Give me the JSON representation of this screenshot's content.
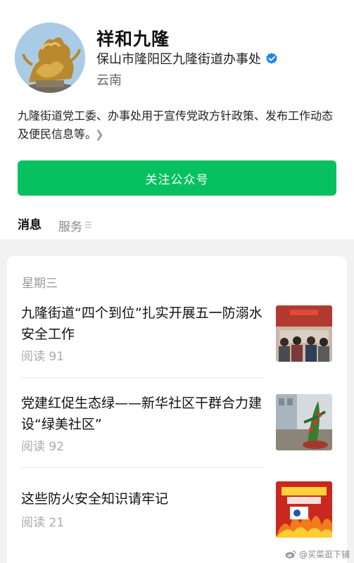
{
  "account": {
    "name": "祥和九隆",
    "org": "保山市隆阳区九隆街道办事处",
    "region": "云南",
    "description": "九隆街道党工委、办事处用于宣传党政方针政策、发布工作动态及便民信息等。",
    "verify_icon": "verified-badge-icon"
  },
  "follow_button": "关注公众号",
  "tabs": [
    {
      "label": "消息",
      "active": true
    },
    {
      "label": "服务",
      "active": false
    }
  ],
  "feed": {
    "day": "星期三",
    "articles": [
      {
        "title": "九隆街道“四个到位”扎实开展五一防溺水安全工作",
        "reads": "阅读 91"
      },
      {
        "title": "党建红促生态绿——新华社区干群合力建设“绿美社区”",
        "reads": "阅读 92"
      },
      {
        "title": "这些防火安全知识请牢记",
        "reads": "阅读 21"
      }
    ]
  },
  "watermark": "@买菜逛下铺",
  "colors": {
    "accent": "#07c160",
    "verify": "#1e88f0"
  }
}
